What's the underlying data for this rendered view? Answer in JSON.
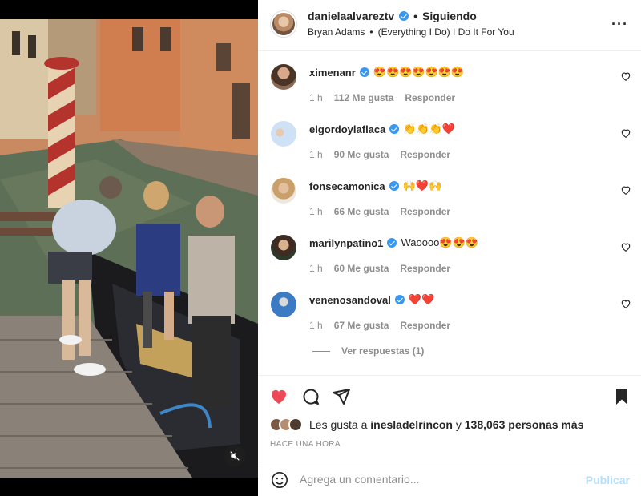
{
  "post": {
    "username": "danielaalvareztv",
    "separator": "•",
    "follow_status": "Siguiendo",
    "audio_artist": "Bryan Adams",
    "audio_track": "(Everything I Do) I Do It For You",
    "more_label": "···"
  },
  "comments": [
    {
      "username": "ximenanr",
      "text": "😍😍😍😍😍😍😍",
      "time": "1 h",
      "likes": "112 Me gusta",
      "reply": "Responder"
    },
    {
      "username": "elgordoylaflaca",
      "text": "👏👏👏❤️",
      "time": "1 h",
      "likes": "90 Me gusta",
      "reply": "Responder"
    },
    {
      "username": "fonsecamonica",
      "text": "🙌❤️🙌",
      "time": "1 h",
      "likes": "66 Me gusta",
      "reply": "Responder"
    },
    {
      "username": "marilynpatino1",
      "text": "Waoooo😍😍😍",
      "time": "1 h",
      "likes": "60 Me gusta",
      "reply": "Responder"
    },
    {
      "username": "venenosandoval",
      "text": "❤️❤️",
      "time": "1 h",
      "likes": "67 Me gusta",
      "reply": "Responder"
    }
  ],
  "view_replies": "Ver respuestas (1)",
  "likes": {
    "prefix": "Les gusta a",
    "first_user": "inesladelrincon",
    "conj": "y",
    "others": "138,063 personas más"
  },
  "time_ago": "HACE UNA HORA",
  "comment_box": {
    "placeholder": "Agrega un comentario...",
    "publish": "Publicar"
  },
  "colors": {
    "like_active": "#ed4956",
    "verified": "#3897f0",
    "publish_disabled": "#b2dffc"
  },
  "icons": [
    "heart-icon",
    "comment-icon",
    "share-icon",
    "bookmark-icon",
    "emoji-icon",
    "mute-icon",
    "more-icon"
  ]
}
